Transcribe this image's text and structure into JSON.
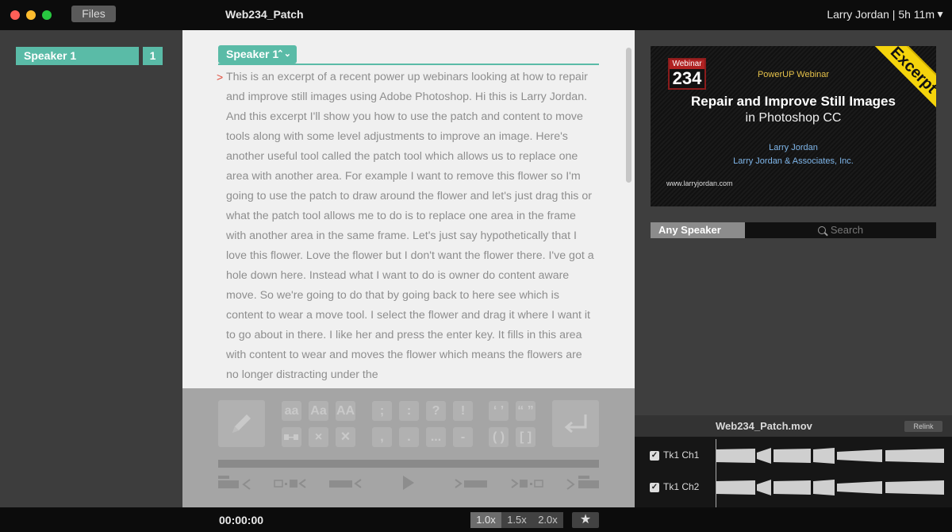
{
  "titlebar": {
    "files_label": "Files",
    "title": "Web234_Patch",
    "user_label": "Larry Jordan | 5h 11m"
  },
  "sidebar": {
    "speakers": [
      {
        "name": "Speaker 1",
        "count": "1"
      }
    ]
  },
  "transcript": {
    "speaker_label": "Speaker 1",
    "marker": ">",
    "text": "This is an excerpt of a recent power up webinars looking at how to repair and improve still images using Adobe Photoshop. Hi this is Larry Jordan. And this excerpt I'll show you how to use the patch and content to move tools along with some level adjustments to improve an image. Here's another useful tool called the patch tool which allows us to replace one area with another area. For example I want to remove this flower so I'm going to use the patch to draw around the flower and let's just drag this or what the patch tool allows me to do is to replace one area in the frame with another area in the same frame. Let's just say hypothetically that I love this flower. Love the flower but I don't want the flower there. I've got a hole down here. Instead what I want to do is owner do content aware move. So we're going to do that by going back to here see which is content to wear a move tool. I select the flower and drag it where I want it to go about in there. I like her and press the enter key. It fills in this area with content to wear and moves the flower which means the flowers are no longer distracting under the"
  },
  "toolbar": {
    "case_buttons": [
      "aa",
      "Aa",
      "AA"
    ],
    "punct_row1": [
      ";",
      ":",
      "?",
      "!"
    ],
    "punct_row2": [
      ",",
      ".",
      "...",
      "-"
    ],
    "quote_buttons": [
      "‘ ’",
      "“ ”"
    ],
    "bracket_buttons": [
      "( )",
      "[ ]"
    ],
    "edit_icons": [
      "pencil-icon",
      "merge-icon",
      "delete-word-icon",
      "delete-all-icon",
      "return-icon"
    ],
    "transport_icons": [
      "previous-speaker-icon",
      "previous-word-icon",
      "previous-sentence-icon",
      "play-icon",
      "next-sentence-icon",
      "next-word-icon",
      "next-speaker-icon"
    ]
  },
  "video": {
    "badge_top": "Webinar",
    "badge_num": "234",
    "banner": "Excerpt",
    "series": "PowerUP Webinar",
    "title": "Repair and Improve Still Images",
    "subtitle": "in Photoshop CC",
    "presenter": "Larry Jordan",
    "company": "Larry Jordan & Associates, Inc.",
    "url": "www.larryjordan.com"
  },
  "search": {
    "speaker_filter": "Any Speaker",
    "placeholder": "Search"
  },
  "audio": {
    "filename": "Web234_Patch.mov",
    "relink_label": "Relink",
    "tracks": [
      {
        "label": "Tk1 Ch1",
        "checked": true
      },
      {
        "label": "Tk1 Ch2",
        "checked": true
      }
    ]
  },
  "bottombar": {
    "timecode": "00:00:00",
    "speeds": [
      "1.0x",
      "1.5x",
      "2.0x"
    ],
    "active_speed": "1.0x",
    "star_label": "★"
  },
  "colors": {
    "accent": "#5abba7",
    "marker": "#e04b3a",
    "banner": "#f5d40c"
  }
}
